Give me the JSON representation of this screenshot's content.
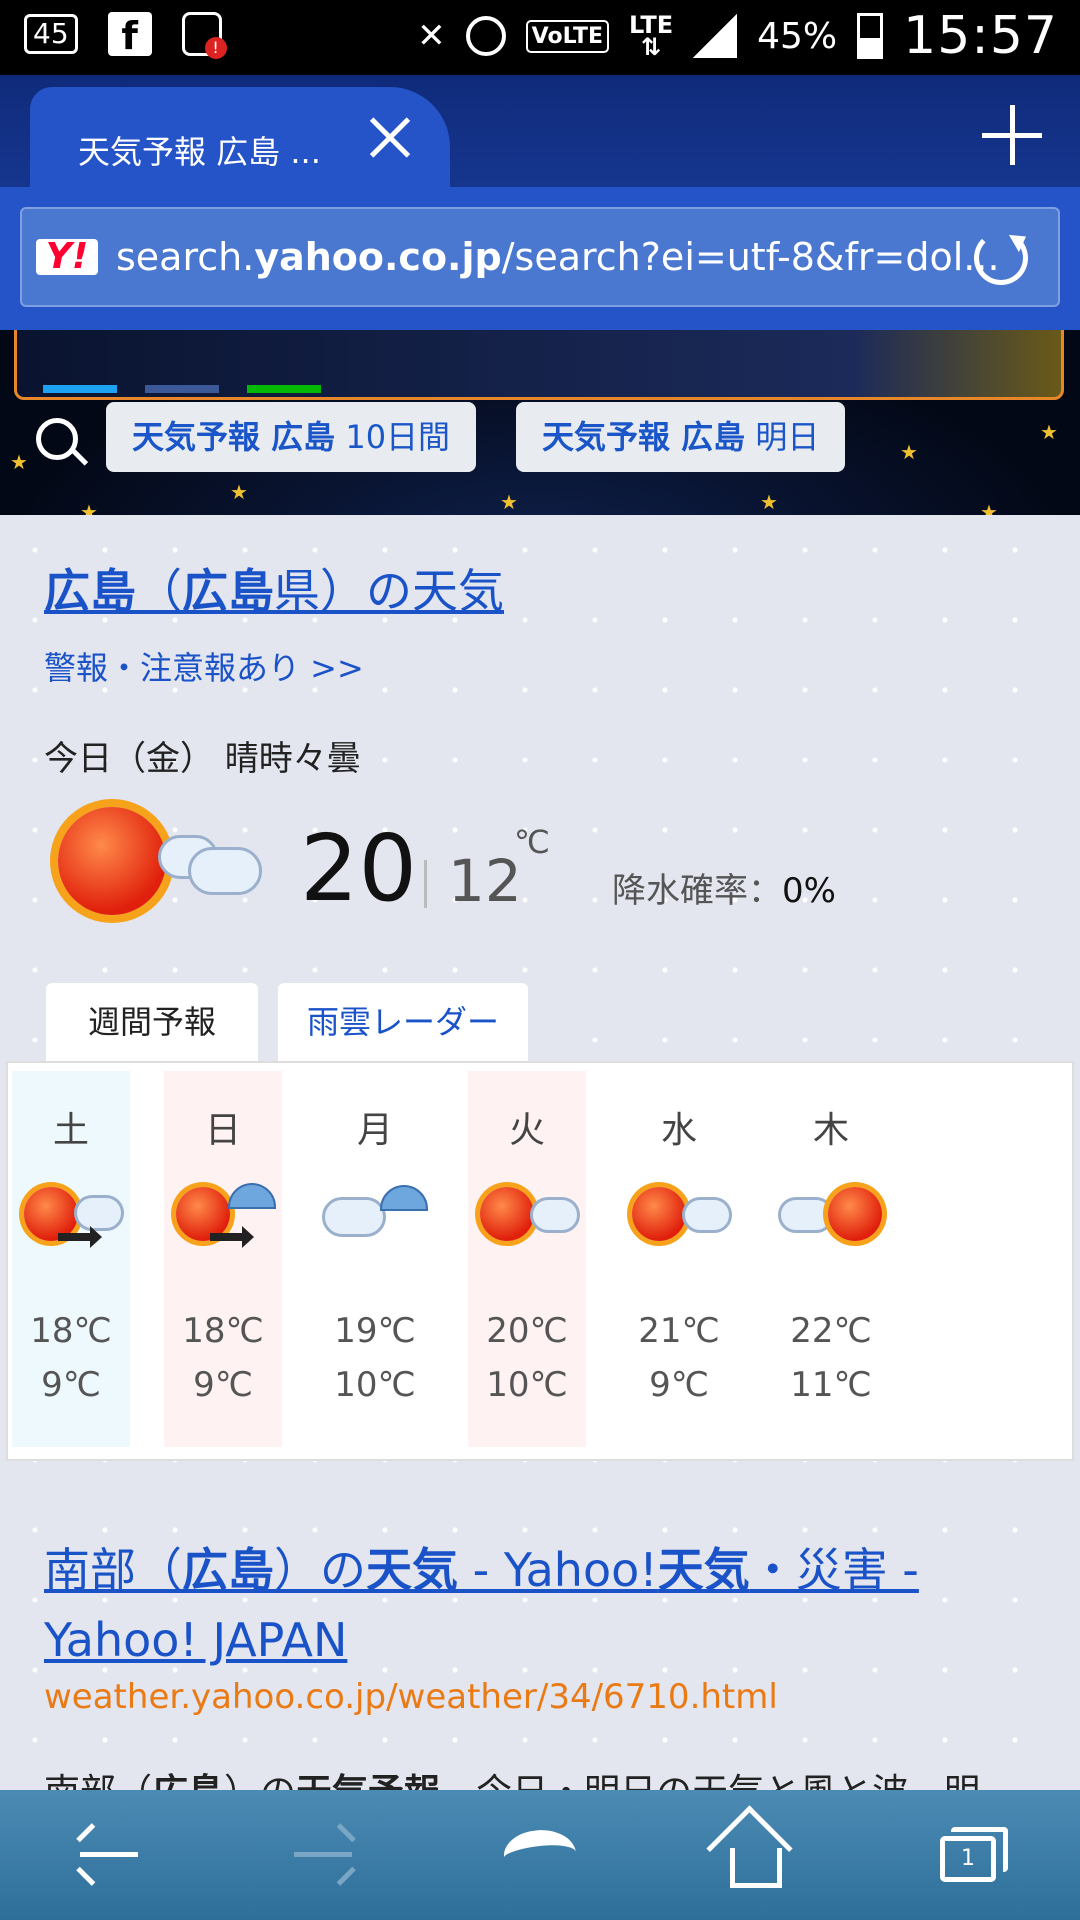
{
  "status_bar": {
    "notif_badge": "45",
    "battery_pct": "45%",
    "time": "15:57",
    "volte": "VoLTE",
    "lte": "LTE"
  },
  "browser": {
    "tab_title": "天気予報 広島 ...",
    "url_host_pre": "search.",
    "url_host_bold": "yahoo.co.jp",
    "url_path": "/search?ei=utf-8&fr=dol...",
    "yahoo_logo": "Y!"
  },
  "related_chips": [
    {
      "bold": "天気予報 広島",
      "rest": " 10日間"
    },
    {
      "bold": "天気予報 広島",
      "rest": " 明日"
    }
  ],
  "weather": {
    "title_bold1": "広島",
    "title_mid1": "（",
    "title_bold2": "広島",
    "title_rest": "県）の天気",
    "warning_link": "警報・注意報あり >>",
    "today_label": "今日（金） 晴時々曇",
    "high": "20",
    "low": "12",
    "unit": "℃",
    "rain_label": "降水確率：",
    "rain_value": "0%",
    "tab_weekly": "週間予報",
    "tab_radar": "雨雲レーダー",
    "days": [
      {
        "name": "土",
        "hi": "18℃",
        "lo": "9℃",
        "icon": "sun-to-cloud"
      },
      {
        "name": "日",
        "hi": "18℃",
        "lo": "9℃",
        "icon": "sun-to-rain"
      },
      {
        "name": "月",
        "hi": "19℃",
        "lo": "10℃",
        "icon": "cloud-rain"
      },
      {
        "name": "火",
        "hi": "20℃",
        "lo": "10℃",
        "icon": "sun-cloud"
      },
      {
        "name": "水",
        "hi": "21℃",
        "lo": "9℃",
        "icon": "sun-cloud"
      },
      {
        "name": "木",
        "hi": "22℃",
        "lo": "11℃",
        "icon": "cloud-sun"
      }
    ]
  },
  "result": {
    "title_p1": "南部（",
    "title_b1": "広島",
    "title_p2": "）の",
    "title_b2": "天気",
    "title_p3": " - Yahoo!",
    "title_b3": "天気",
    "title_p4": "・災害 - Yahoo! JAPAN",
    "url": "weather.yahoo.co.jp/weather/34/6710.html",
    "snippet_p1": "南部（",
    "snippet_b1": "広島",
    "snippet_p2": "）の",
    "snippet_b2": "天気予報",
    "snippet_p3": "。今日・明日の天気と風と波、明"
  },
  "colors": {
    "link": "#1a52c8",
    "url_orange": "#ea7a14",
    "chrome_blue": "#2554c8"
  }
}
